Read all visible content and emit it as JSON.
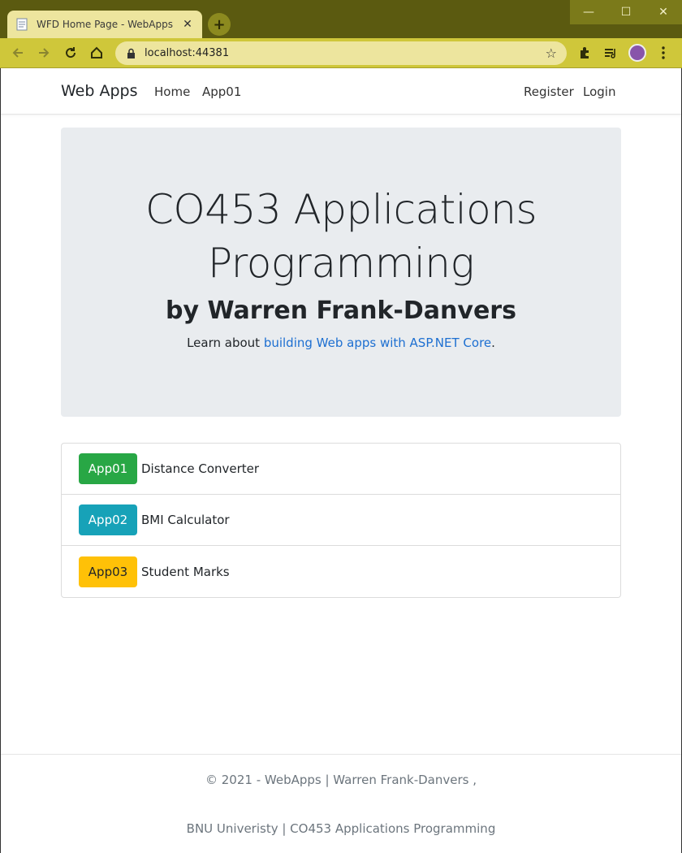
{
  "browser": {
    "tab_title": "WFD Home Page - WebApps",
    "tab_close": "✕",
    "new_tab": "+",
    "url": "localhost:44381",
    "window_controls": {
      "minimize": "—",
      "maximize": "☐",
      "close": "✕"
    }
  },
  "navbar": {
    "brand": "Web Apps",
    "links": [
      "Home",
      "App01"
    ],
    "right_links": [
      "Register",
      "Login"
    ]
  },
  "jumbotron": {
    "title_line1": "CO453 Applications",
    "title_line2": "Programming",
    "subtitle": "by Warren Frank-Danvers",
    "lead_prefix": "Learn about ",
    "lead_link": "building Web apps with ASP.NET Core",
    "lead_suffix": "."
  },
  "apps": [
    {
      "button": "App01",
      "label": "Distance Converter",
      "color": "#28a745"
    },
    {
      "button": "App02",
      "label": "BMI Calculator",
      "color": "#17a2b8"
    },
    {
      "button": "App03",
      "label": "Student Marks",
      "color": "#ffc107"
    }
  ],
  "footer": {
    "line1": "© 2021 - WebApps | Warren Frank-Danvers ,",
    "line2": "BNU Univeristy | CO453 Applications Programming"
  }
}
